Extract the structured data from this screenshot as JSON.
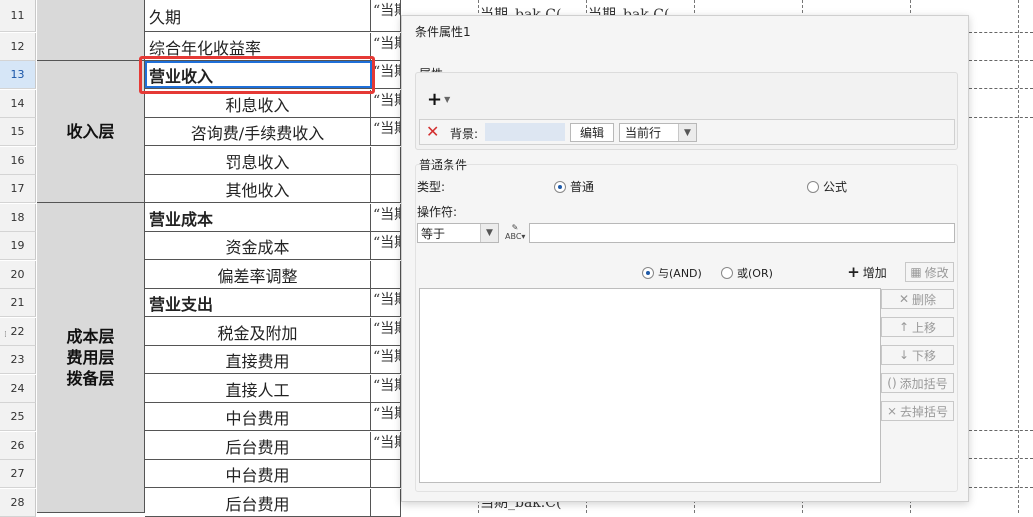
{
  "rows": [
    {
      "num": "11",
      "name": "久期",
      "style": "plain",
      "val": "“当期_bak.C(“当期_bak.C(“当期_bak.C("
    },
    {
      "num": "12",
      "name": "综合年化收益率",
      "style": "plain",
      "val": "“当期"
    },
    {
      "num": "13",
      "name": "营业收入",
      "style": "bold",
      "val": "“当期",
      "active": true
    },
    {
      "num": "14",
      "name": "利息收入",
      "style": "indent",
      "val": "“当期"
    },
    {
      "num": "15",
      "name": "咨询费/手续费收入",
      "style": "indent",
      "val": "“当期"
    },
    {
      "num": "16",
      "name": "罚息收入",
      "style": "indent",
      "val": ""
    },
    {
      "num": "17",
      "name": "其他收入",
      "style": "indent",
      "val": ""
    },
    {
      "num": "18",
      "name": "营业成本",
      "style": "bold",
      "val": "“当期"
    },
    {
      "num": "19",
      "name": "资金成本",
      "style": "indent",
      "val": "“当期"
    },
    {
      "num": "20",
      "name": "偏差率调整",
      "style": "indent",
      "val": ""
    },
    {
      "num": "21",
      "name": "营业支出",
      "style": "bold",
      "val": "“当期"
    },
    {
      "num": "22",
      "name": "税金及附加",
      "style": "indent",
      "val": "“当期"
    },
    {
      "num": "23",
      "name": "直接费用",
      "style": "indent",
      "val": "“当期"
    },
    {
      "num": "24",
      "name": "直接人工",
      "style": "indent",
      "val": "“当期"
    },
    {
      "num": "25",
      "name": "中台费用",
      "style": "indent",
      "val": "“当期"
    },
    {
      "num": "26",
      "name": "后台费用",
      "style": "indent",
      "val": "“当期"
    },
    {
      "num": "27",
      "name": "中台费用",
      "style": "indent",
      "val": ""
    },
    {
      "num": "28",
      "name": "后台费用",
      "style": "indent",
      "val": ""
    }
  ],
  "groups": {
    "income": "收入层",
    "cost": "成本层\n费用层\n拨备层"
  },
  "fragments": {
    "row11_a": "当期_bak.C(",
    "row11_b": "当期_bak.C(",
    "row28": "当期_bak.C("
  },
  "dialog": {
    "title": "条件属性1",
    "attr_section": "属性",
    "plus": "+",
    "background_label": "背景:",
    "edit_button": "编辑",
    "scope_select": "当前行",
    "normal_condition": "普通条件",
    "type_label": "类型:",
    "type_normal": "普通",
    "type_formula": "公式",
    "operator_label": "操作符:",
    "operator_value": "等于",
    "and_label": "与(AND)",
    "or_label": "或(OR)",
    "add_button": "增加",
    "modify_button": "修改",
    "delete_button": "删除",
    "up_button": "上移",
    "down_button": "下移",
    "add_bracket_button": "添加括号",
    "remove_bracket_button": "去掉括号"
  },
  "colors": {
    "selection_border": "#e53935",
    "active_cell_border": "#1e6fd9",
    "group_bg": "#d9d9d9",
    "delete_icon": "#d32f2f"
  }
}
